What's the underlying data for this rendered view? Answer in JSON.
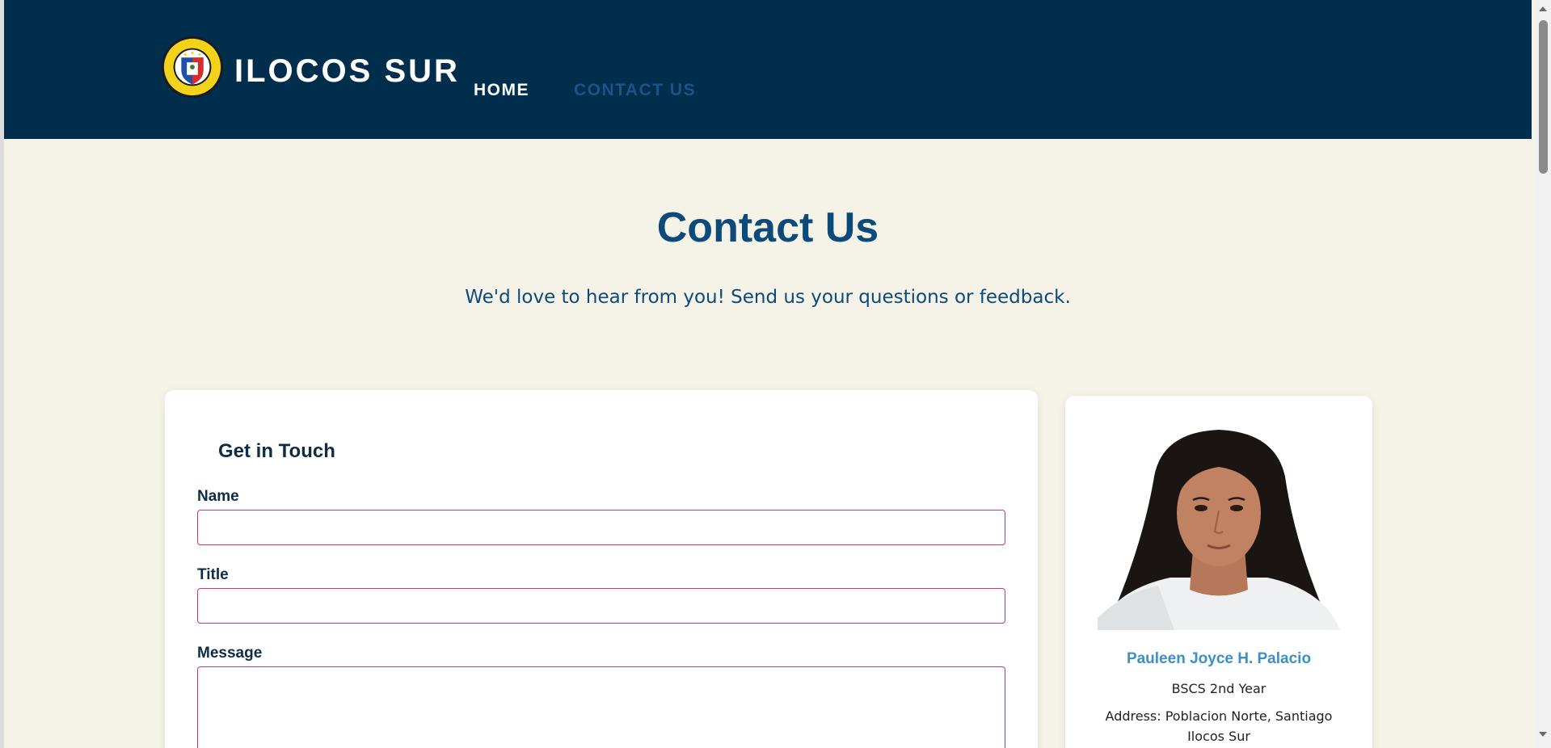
{
  "header": {
    "brand": "ILOCOS SUR",
    "logo": "ilocos-sur-official-seal",
    "nav": [
      {
        "label": "HOME",
        "active": false
      },
      {
        "label": "CONTACT US",
        "active": true
      }
    ]
  },
  "hero": {
    "title": "Contact Us",
    "subtitle": "We'd love to hear from you! Send us your questions or feedback."
  },
  "form": {
    "heading": "Get in Touch",
    "fields": [
      {
        "label": "Name",
        "value": "",
        "placeholder": ""
      },
      {
        "label": "Title",
        "value": "",
        "placeholder": ""
      },
      {
        "label": "Message",
        "value": "",
        "placeholder": ""
      }
    ]
  },
  "profile": {
    "name": "Pauleen Joyce H. Palacio",
    "year": "BSCS 2nd Year",
    "address": "Address: Poblacion Norte, Santiago Ilocos Sur"
  },
  "colors": {
    "header_bg": "#012e4d",
    "page_bg": "#f5f2e8",
    "title": "#0c4a7a",
    "input_border": "#d4366a",
    "profile_name": "#3d8fc4",
    "nav_active": "#1a5489"
  }
}
